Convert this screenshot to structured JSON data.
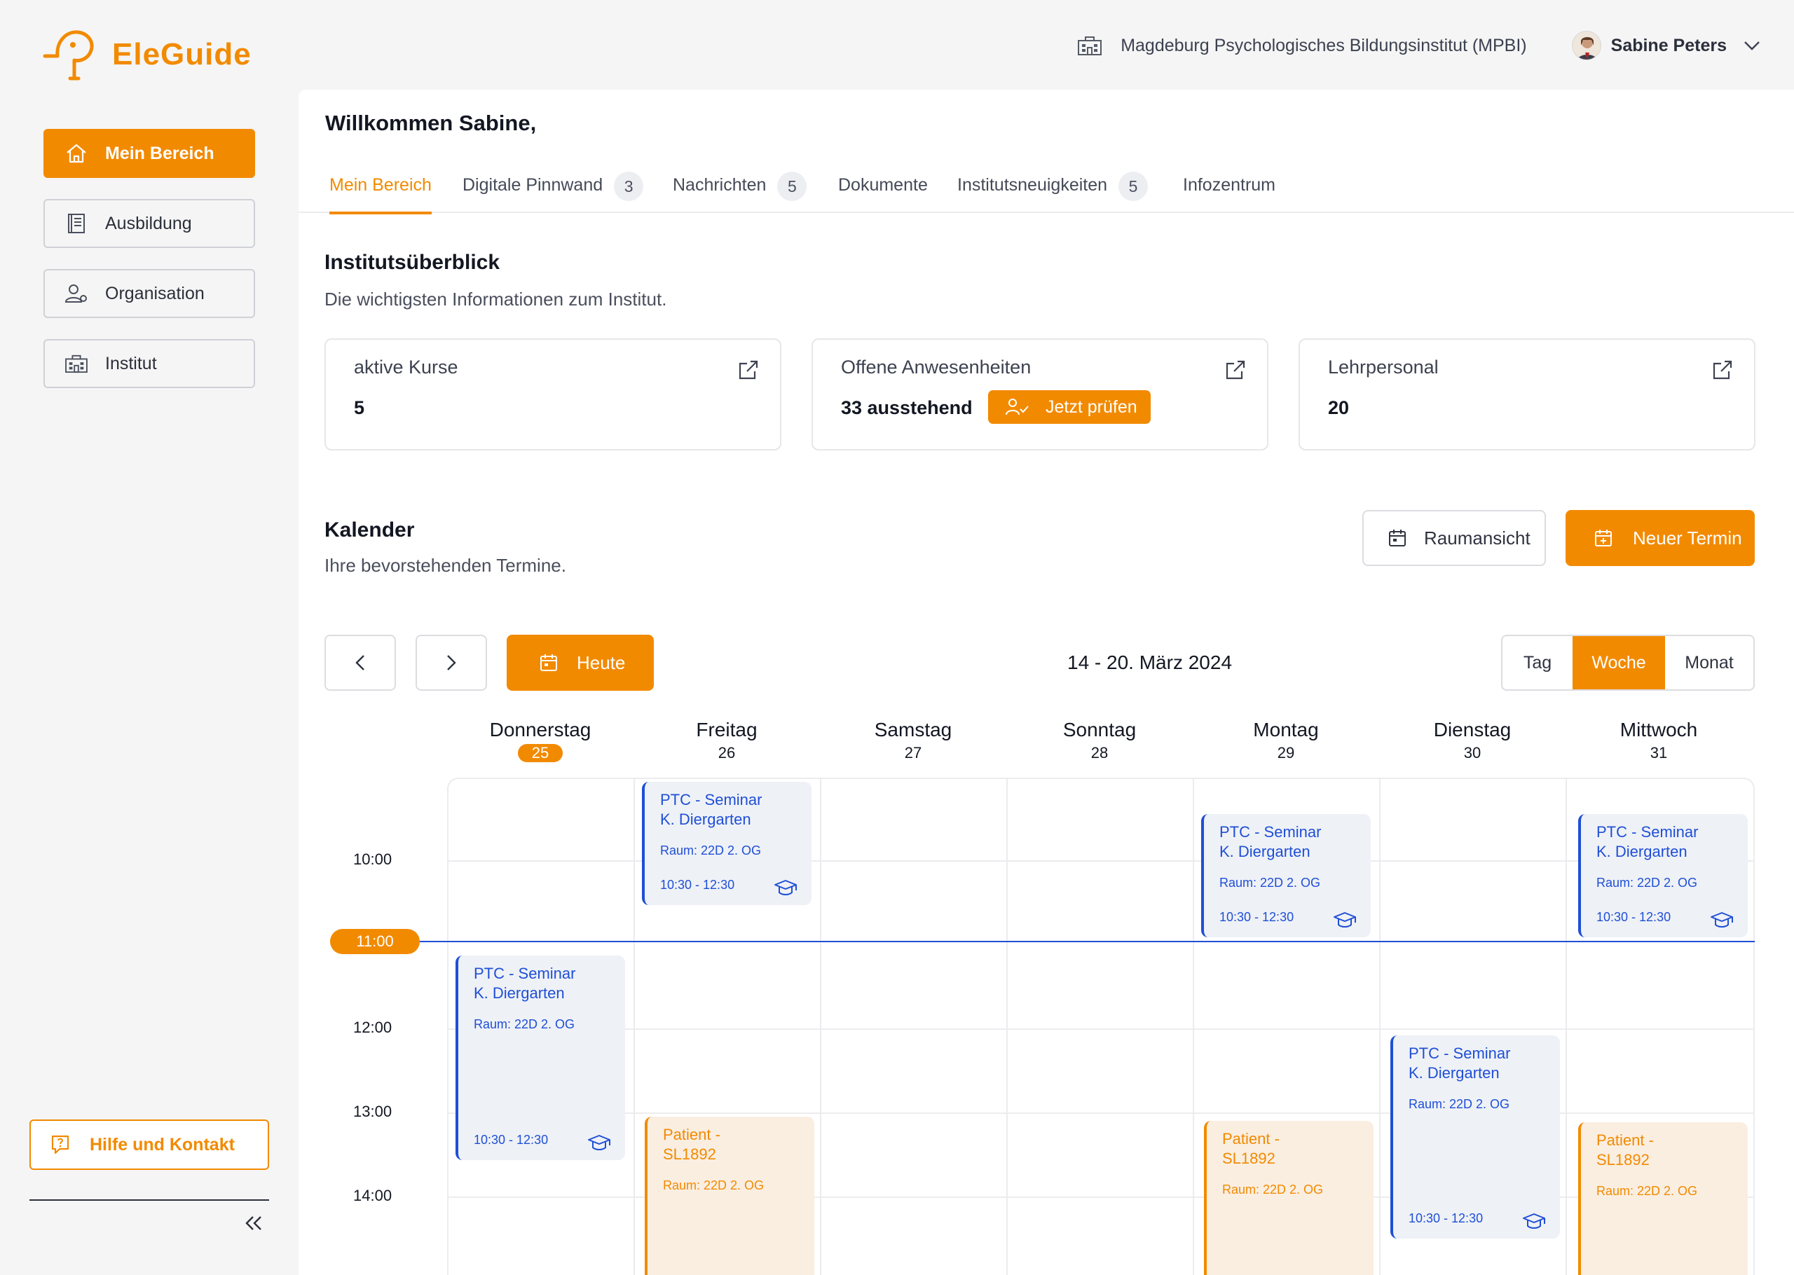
{
  "app": {
    "logo_text": "EleGuide"
  },
  "header": {
    "institute": "Magdeburg Psychologisches Bildungsinstitut (MPBI)",
    "user_name": "Sabine Peters"
  },
  "sidebar": {
    "items": [
      {
        "label": "Mein Bereich",
        "icon": "home-icon",
        "active": true
      },
      {
        "label": "Ausbildung",
        "icon": "book-icon",
        "active": false
      },
      {
        "label": "Organisation",
        "icon": "user-settings-icon",
        "active": false
      },
      {
        "label": "Institut",
        "icon": "building-icon",
        "active": false
      }
    ],
    "help_label": "Hilfe und Kontakt"
  },
  "main": {
    "welcome": "Willkommen Sabine,",
    "tabs": [
      {
        "label": "Mein Bereich",
        "badge": "",
        "active": true
      },
      {
        "label": "Digitale Pinnwand",
        "badge": "3"
      },
      {
        "label": "Nachrichten",
        "badge": "5"
      },
      {
        "label": "Dokumente",
        "badge": ""
      },
      {
        "label": "Institutsneuigkeiten",
        "badge": "5"
      },
      {
        "label": "Infozentrum",
        "badge": ""
      }
    ],
    "overview": {
      "title": "Institutsüberblick",
      "subtitle": "Die wichtigsten Informationen zum Institut.",
      "cards": [
        {
          "title": "aktive Kurse",
          "value": "5"
        },
        {
          "title": "Offene Anwesenheiten",
          "value": "33 ausstehend",
          "action": "Jetzt prüfen"
        },
        {
          "title": "Lehrpersonal",
          "value": "20"
        }
      ]
    },
    "calendar": {
      "title": "Kalender",
      "subtitle": "Ihre bevorstehenden Termine.",
      "room_view_label": "Raumansicht",
      "new_event_label": "Neuer Termin",
      "today_label": "Heute",
      "date_range": "14 - 20. März 2024",
      "views": [
        {
          "label": "Tag",
          "active": false
        },
        {
          "label": "Woche",
          "active": true
        },
        {
          "label": "Monat",
          "active": false
        }
      ],
      "days": [
        {
          "name": "Donnerstag",
          "num": "25",
          "today": true
        },
        {
          "name": "Freitag",
          "num": "26"
        },
        {
          "name": "Samstag",
          "num": "27"
        },
        {
          "name": "Sonntag",
          "num": "28"
        },
        {
          "name": "Montag",
          "num": "29"
        },
        {
          "name": "Dienstag",
          "num": "30"
        },
        {
          "name": "Mittwoch",
          "num": "31"
        }
      ],
      "times": [
        "10:00",
        "12:00",
        "13:00",
        "14:00"
      ],
      "current_time": "11:00",
      "events": [
        {
          "type": "seminar",
          "day": 0,
          "line1": "PTC - Seminar",
          "line2": "K. Diergarten",
          "room": "Raum: 22D 2. OG",
          "time": "10:30 - 12:30"
        },
        {
          "type": "seminar",
          "day": 1,
          "line1": "PTC - Seminar",
          "line2": "K. Diergarten",
          "room": "Raum: 22D 2. OG",
          "time": "10:30 - 12:30"
        },
        {
          "type": "seminar",
          "day": 4,
          "line1": "PTC - Seminar",
          "line2": "K. Diergarten",
          "room": "Raum: 22D 2. OG",
          "time": "10:30 - 12:30"
        },
        {
          "type": "seminar",
          "day": 6,
          "line1": "PTC - Seminar",
          "line2": "K. Diergarten",
          "room": "Raum: 22D 2. OG",
          "time": "10:30 - 12:30"
        },
        {
          "type": "seminar",
          "day": 5,
          "line1": "PTC - Seminar",
          "line2": "K. Diergarten",
          "room": "Raum: 22D 2. OG",
          "time": "10:30 - 12:30"
        },
        {
          "type": "patient",
          "day": 1,
          "line1": "Patient -",
          "line2": "SL1892",
          "room": "Raum: 22D 2. OG"
        },
        {
          "type": "patient",
          "day": 4,
          "line1": "Patient -",
          "line2": "SL1892",
          "room": "Raum: 22D 2. OG"
        },
        {
          "type": "patient",
          "day": 6,
          "line1": "Patient -",
          "line2": "SL1892",
          "room": "Raum: 22D 2. OG"
        }
      ]
    }
  },
  "colors": {
    "accent": "#f28a00",
    "seminar": "#1f4fd6",
    "seminar_bg": "#eef1f6",
    "patient_bg": "#faeee1"
  }
}
